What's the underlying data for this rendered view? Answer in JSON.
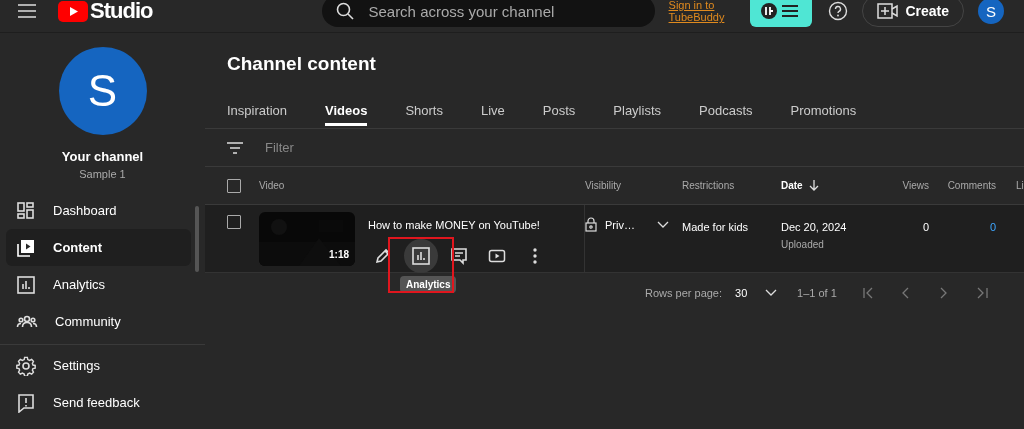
{
  "header": {
    "logo_text": "Studio",
    "search_placeholder": "Search across your channel",
    "tubebuddy": {
      "line1": "Sign in to",
      "line2": "TubeBuddy"
    },
    "create_label": "Create",
    "account_initial": "S"
  },
  "sidebar": {
    "channel": {
      "initial": "S",
      "title": "Your channel",
      "name": "Sample 1"
    },
    "items": [
      {
        "label": "Dashboard",
        "kind": "dashboard",
        "selected": false
      },
      {
        "label": "Content",
        "kind": "content",
        "selected": true
      },
      {
        "label": "Analytics",
        "kind": "analytics",
        "selected": false
      },
      {
        "label": "Community",
        "kind": "community",
        "selected": false
      }
    ],
    "footer_items": [
      {
        "label": "Settings",
        "kind": "settings"
      },
      {
        "label": "Send feedback",
        "kind": "feedback"
      }
    ]
  },
  "content": {
    "title": "Channel content",
    "tabs": [
      {
        "label": "Inspiration",
        "selected": false
      },
      {
        "label": "Videos",
        "selected": true
      },
      {
        "label": "Shorts",
        "selected": false
      },
      {
        "label": "Live",
        "selected": false
      },
      {
        "label": "Posts",
        "selected": false
      },
      {
        "label": "Playlists",
        "selected": false
      },
      {
        "label": "Podcasts",
        "selected": false
      },
      {
        "label": "Promotions",
        "selected": false
      }
    ],
    "filter_placeholder": "Filter",
    "select_all_checked": false,
    "columns": [
      {
        "label": "Video",
        "sorted": false
      },
      {
        "label": "Visibility",
        "sorted": false
      },
      {
        "label": "Restrictions",
        "sorted": false
      },
      {
        "label": "Date",
        "sorted": true
      },
      {
        "label": "Views",
        "sorted": false
      },
      {
        "label": "Comments",
        "sorted": false
      },
      {
        "label": "Li",
        "sorted": false
      }
    ],
    "rows": [
      {
        "checked": false,
        "duration": "1:18",
        "title": "How to make MONEY on YouTube!",
        "visibility": "Priv…",
        "restrictions": "Made for kids",
        "date": "Dec 20, 2024",
        "date_status": "Uploaded",
        "views": "0",
        "comments": "0",
        "actions": [
          {
            "kind": "edit",
            "hovered": false
          },
          {
            "kind": "analytics",
            "hovered": true
          },
          {
            "kind": "comments",
            "hovered": false
          },
          {
            "kind": "play",
            "hovered": false
          },
          {
            "kind": "more",
            "hovered": false
          }
        ],
        "tooltip": "Analytics"
      }
    ],
    "pagination": {
      "label": "Rows per page:",
      "rows": "30",
      "range": "1–1 of 1"
    }
  }
}
